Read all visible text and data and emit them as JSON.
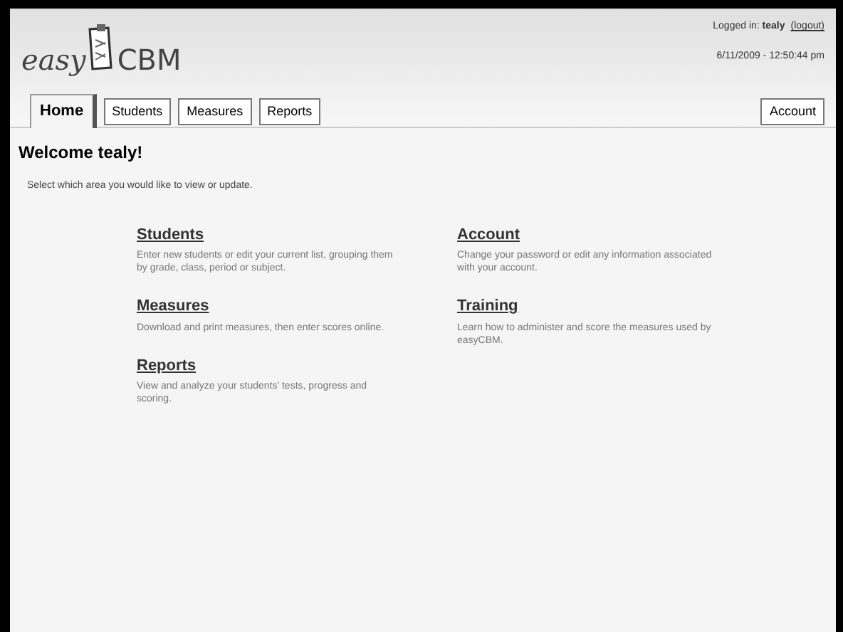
{
  "logo": {
    "left": "easy",
    "right": "CBM"
  },
  "user": {
    "logged_in": "Logged in: **tealy**",
    "logout": "(logout)",
    "datetime": "6/11/2009 - 12:50:44 pm"
  },
  "tabs": [
    {
      "label": "Home",
      "selected": true
    },
    {
      "label": "Students",
      "selected": false
    },
    {
      "label": "Measures",
      "selected": false
    },
    {
      "label": "Reports",
      "selected": false
    }
  ],
  "right_tab": {
    "label": "Account",
    "selected": false
  },
  "welcome": "Welcome tealy!",
  "intro": "Select which area you would like to view or update.",
  "sections": [
    [
      {
        "title": "Students",
        "text": "Enter new students or edit your current list, grouping them by grade, class, period or subject."
      },
      {
        "title": "Measures",
        "text": "Download and print measures, then enter scores online."
      },
      {
        "title": "Reports",
        "text": "View and analyze your students' tests, progress and scoring."
      }
    ],
    [
      {
        "title": "Account",
        "text": "Change your password or edit any information associated with your account."
      },
      {
        "title": "Training",
        "text": "Learn how to administer and score the measures used by easyCBM."
      }
    ]
  ]
}
